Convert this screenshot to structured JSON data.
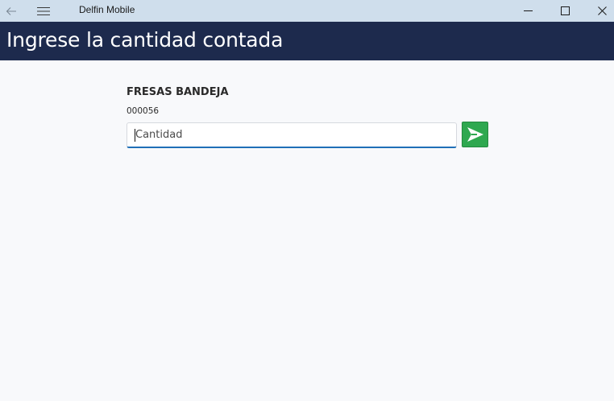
{
  "window": {
    "app_title": "Delfin Mobile",
    "icons": {
      "back": "back-arrow-icon",
      "menu": "hamburger-menu-icon",
      "minimize": "minimize-icon",
      "maximize": "maximize-icon",
      "close": "close-icon"
    }
  },
  "header": {
    "title": "Ingrese la cantidad contada"
  },
  "form": {
    "product_name": "FRESAS BANDEJA",
    "product_code": "000056",
    "quantity": {
      "value": "",
      "placeholder": "Cantidad"
    },
    "submit_icon": "send-arrow-icon"
  },
  "colors": {
    "titlebar_bg": "#cfdeec",
    "header_bg": "#1d2a4d",
    "page_bg": "#f8f9fb",
    "input_focus_border": "#1f6fb7",
    "submit_bg": "#2fa84f"
  }
}
